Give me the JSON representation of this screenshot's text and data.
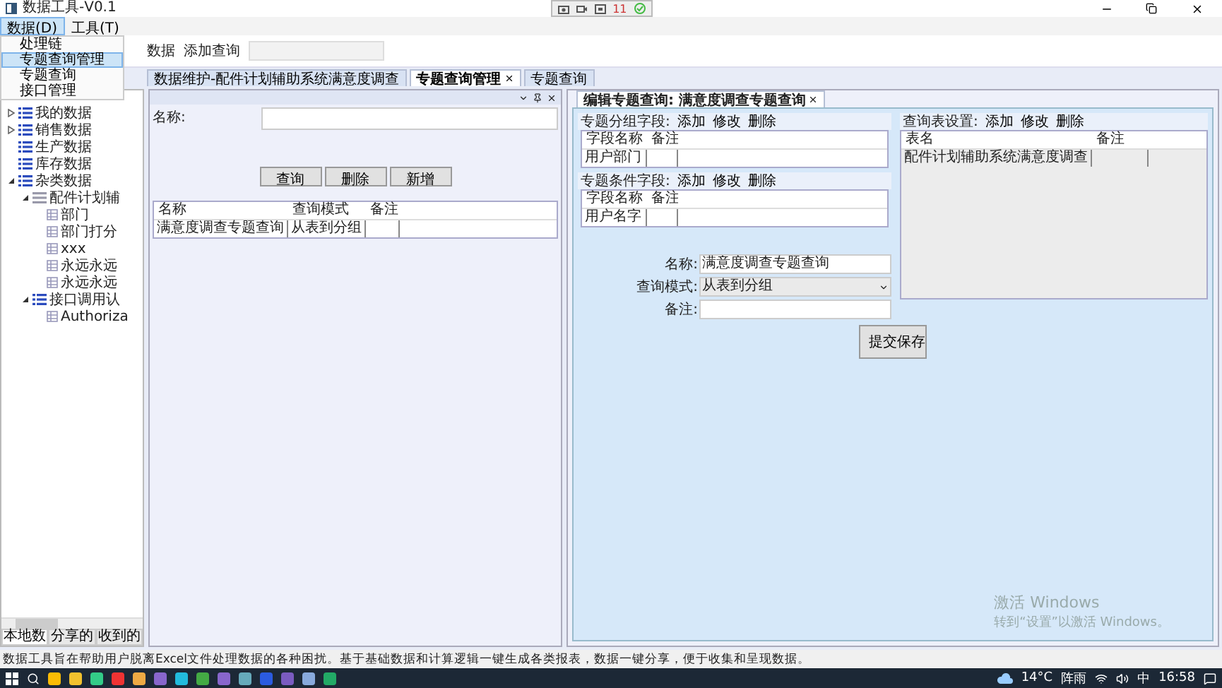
{
  "window": {
    "title": "数据工具-V0.1"
  },
  "title_toolbar": {
    "count": "11"
  },
  "menu": [
    {
      "label": "数据(D)",
      "selected": true
    },
    {
      "label": "工具(T)",
      "selected": false
    }
  ],
  "dropdown": [
    {
      "label": "处理链",
      "selected": false
    },
    {
      "label": "专题查询管理",
      "selected": true
    },
    {
      "label": "专题查询",
      "selected": false
    },
    {
      "label": "接口管理",
      "selected": false
    }
  ],
  "ribbon": {
    "group_label": "数据",
    "add_query_label": "添加查询"
  },
  "doc_tabs": [
    {
      "label": "数据维护-配件计划辅助系统满意度调查",
      "selected": false,
      "closable": false
    },
    {
      "label": "专题查询管理",
      "selected": true,
      "closable": true
    },
    {
      "label": "专题查询",
      "selected": false,
      "closable": false
    }
  ],
  "tree": [
    {
      "label": "我的数据",
      "kind": "list",
      "expanded": false
    },
    {
      "label": "销售数据",
      "kind": "list",
      "expanded": false
    },
    {
      "label": "生产数据",
      "kind": "list"
    },
    {
      "label": "库存数据",
      "kind": "list"
    },
    {
      "label": "杂类数据",
      "kind": "list",
      "expanded": true,
      "children": [
        {
          "label": "配件计划辅",
          "kind": "group",
          "expanded": true,
          "children": [
            {
              "label": "部门",
              "kind": "table"
            },
            {
              "label": "部门打分",
              "kind": "table"
            },
            {
              "label": "xxx",
              "kind": "table"
            },
            {
              "label": "永远永远",
              "kind": "table"
            },
            {
              "label": "永远永远",
              "kind": "table"
            }
          ]
        },
        {
          "label": "接口调用认",
          "kind": "list",
          "expanded": true,
          "children": [
            {
              "label": "Authoriza",
              "kind": "table"
            }
          ]
        }
      ]
    }
  ],
  "left_tabs": [
    {
      "label": "本地数",
      "selected": true
    },
    {
      "label": "分享的",
      "selected": false
    },
    {
      "label": "收到的",
      "selected": false
    }
  ],
  "query_panel": {
    "name_label": "名称:",
    "buttons": [
      "查询",
      "删除",
      "新增"
    ],
    "columns": [
      "名称",
      "查询模式",
      "备注"
    ],
    "rows": [
      [
        "满意度调查专题查询",
        "从表到分组"
      ]
    ]
  },
  "editor": {
    "tab": {
      "label": "编辑专题查询: 满意度调查专题查询",
      "selected": true
    },
    "sections": [
      {
        "title": "专题分组字段:",
        "actions": [
          "添加",
          "修改",
          "删除"
        ],
        "columns": [
          "字段名称",
          "备注"
        ],
        "rows": [
          [
            "用户部门"
          ]
        ]
      },
      {
        "title": "专题条件字段:",
        "actions": [
          "添加",
          "修改",
          "删除"
        ],
        "columns": [
          "字段名称",
          "备注"
        ],
        "rows": [
          [
            "用户名字"
          ]
        ]
      }
    ],
    "table_settings": {
      "title": "查询表设置:",
      "actions": [
        "添加",
        "修改",
        "删除"
      ],
      "columns": [
        "表名",
        "备注"
      ],
      "rows": [
        [
          "配件计划辅助系统满意度调查"
        ]
      ]
    },
    "form": [
      {
        "label": "名称:",
        "kind": "text",
        "value": "满意度调查专题查询"
      },
      {
        "label": "查询模式:",
        "kind": "select",
        "value": "从表到分组"
      },
      {
        "label": "备注:",
        "kind": "text"
      }
    ],
    "submit": "提交保存"
  },
  "activation": {
    "title": "激活 Windows",
    "hint": "转到“设置”以激活 Windows。"
  },
  "status_bar": "数据工具旨在帮助用户脱离Excel文件处理数据的各种困扰。基于基础数据和计算逻辑一键生成各类报表，数据一键分享，便于收集和呈现数据。",
  "taskbar": {
    "temperature": "14°C",
    "weather": "阵雨",
    "ime": "中",
    "time": "16:58"
  }
}
